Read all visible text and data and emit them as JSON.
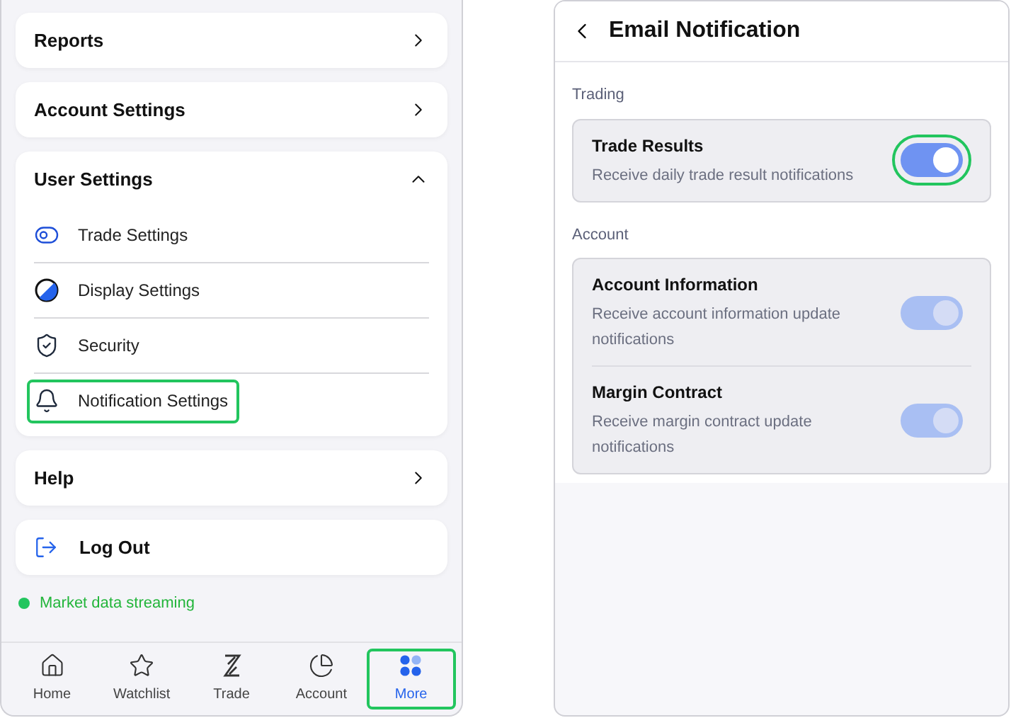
{
  "menu": [
    {
      "kind": "link",
      "title": "Reports"
    },
    {
      "kind": "link",
      "title": "Account Settings"
    },
    {
      "kind": "group",
      "title": "User Settings",
      "expanded": true,
      "items": [
        {
          "label": "Trade Settings",
          "highlighted": false
        },
        {
          "label": "Display Settings",
          "highlighted": false
        },
        {
          "label": "Security",
          "highlighted": false
        },
        {
          "label": "Notification Settings",
          "highlighted": true
        }
      ]
    },
    {
      "kind": "link",
      "title": "Help"
    },
    {
      "kind": "logout",
      "title": "Log Out"
    }
  ],
  "status": {
    "text": "Market data streaming"
  },
  "tab_bar": [
    {
      "label": "Home",
      "selected": false,
      "highlighted": false
    },
    {
      "label": "Watchlist",
      "selected": false,
      "highlighted": false
    },
    {
      "label": "Trade",
      "selected": false,
      "highlighted": false
    },
    {
      "label": "Account",
      "selected": false,
      "highlighted": false
    },
    {
      "label": "More",
      "selected": true,
      "highlighted": true
    }
  ],
  "email_notification": {
    "title": "Email Notification",
    "groups": [
      {
        "label": "Trading",
        "items": [
          {
            "title": "Trade Results",
            "description": "Receive daily trade result notifications",
            "on": true,
            "disabled": false,
            "highlighted": true
          }
        ]
      },
      {
        "label": "Account",
        "items": [
          {
            "title": "Account Information",
            "description": "Receive account information update notifications",
            "on": true,
            "disabled": true
          },
          {
            "title": "Margin Contract",
            "description": "Receive margin contract update notifications",
            "on": true,
            "disabled": true
          }
        ]
      }
    ]
  }
}
